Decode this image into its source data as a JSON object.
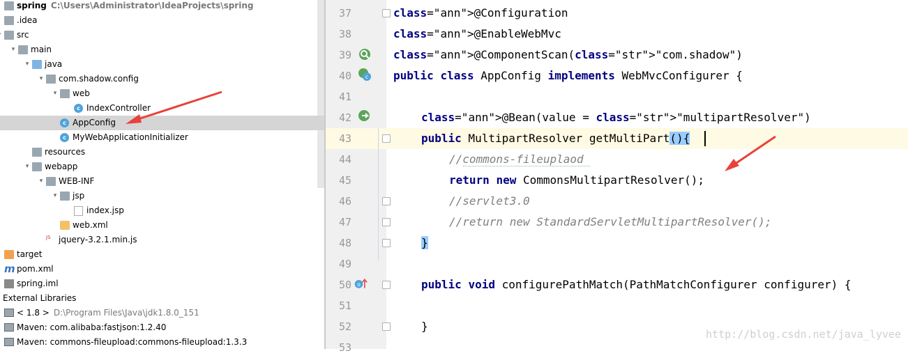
{
  "project": {
    "name": "spring",
    "path": "C:\\Users\\Administrator\\IdeaProjects\\spring"
  },
  "tree": [
    {
      "label": "spring",
      "depth": 0,
      "icon": "project-folder-icon",
      "bold": true
    },
    {
      "label": ".idea",
      "depth": 0,
      "icon": "folder-icon"
    },
    {
      "label": "src",
      "depth": 0,
      "icon": "folder-icon"
    },
    {
      "label": "main",
      "depth": 1,
      "icon": "folder-icon"
    },
    {
      "label": "java",
      "depth": 2,
      "icon": "source-folder-icon"
    },
    {
      "label": "com.shadow.config",
      "depth": 3,
      "icon": "package-icon"
    },
    {
      "label": "web",
      "depth": 4,
      "icon": "package-icon"
    },
    {
      "label": "IndexController",
      "depth": 5,
      "icon": "class-icon"
    },
    {
      "label": "AppConfig",
      "depth": 4,
      "icon": "class-icon"
    },
    {
      "label": "MyWebApplicationInitializer",
      "depth": 4,
      "icon": "class-icon"
    },
    {
      "label": "resources",
      "depth": 2,
      "icon": "resources-folder-icon"
    },
    {
      "label": "webapp",
      "depth": 2,
      "icon": "web-folder-icon"
    },
    {
      "label": "WEB-INF",
      "depth": 3,
      "icon": "folder-icon"
    },
    {
      "label": "jsp",
      "depth": 4,
      "icon": "folder-icon"
    },
    {
      "label": "index.jsp",
      "depth": 5,
      "icon": "jsp-icon"
    },
    {
      "label": "web.xml",
      "depth": 4,
      "icon": "xml-icon"
    },
    {
      "label": "jquery-3.2.1.min.js",
      "depth": 3,
      "icon": "js-icon"
    },
    {
      "label": "target",
      "depth": 0,
      "icon": "excluded-folder-icon"
    },
    {
      "label": "pom.xml",
      "depth": 0,
      "icon": "maven-icon"
    },
    {
      "label": "spring.iml",
      "depth": 0,
      "icon": "iml-icon"
    },
    {
      "label": "External Libraries",
      "depth": 0,
      "icon": "libraries-icon"
    },
    {
      "label": "< 1.8 >",
      "depth": 1,
      "icon": "jdk-icon",
      "path": "D:\\Program Files\\Java\\jdk1.8.0_151"
    },
    {
      "label": "Maven: com.alibaba:fastjson:1.2.40",
      "depth": 1,
      "icon": "library-icon"
    },
    {
      "label": "Maven: commons-fileupload:commons-fileupload:1.3.3",
      "depth": 1,
      "icon": "library-icon"
    }
  ],
  "editor": {
    "lines": [
      {
        "n": "37",
        "text": "@Configuration"
      },
      {
        "n": "38",
        "text": "@EnableWebMvc"
      },
      {
        "n": "39",
        "text": "@ComponentScan(\"com.shadow\")"
      },
      {
        "n": "40",
        "text": "public class AppConfig implements WebMvcConfigurer {"
      },
      {
        "n": "41",
        "text": ""
      },
      {
        "n": "42",
        "text": "@Bean(value = \"multipartResolver\")"
      },
      {
        "n": "43",
        "text": "public MultipartResolver getMultiPart(){"
      },
      {
        "n": "44",
        "text": "//commons-fileuplaod"
      },
      {
        "n": "45",
        "text": "return new CommonsMultipartResolver();"
      },
      {
        "n": "46",
        "text": "//servlet3.0"
      },
      {
        "n": "47",
        "text": "//return new StandardServletMultipartResolver();"
      },
      {
        "n": "48",
        "text": "}"
      },
      {
        "n": "49",
        "text": ""
      },
      {
        "n": "50",
        "text": "public void configurePathMatch(PathMatchConfigurer configurer) {"
      },
      {
        "n": "51",
        "text": ""
      },
      {
        "n": "52",
        "text": "}"
      },
      {
        "n": "53",
        "text": ""
      }
    ]
  },
  "watermark": "http://blog.csdn.net/java_lyvee",
  "colors": {
    "keyword": "#000080",
    "annotation": "#808000",
    "string": "#008000",
    "comment": "#808080",
    "selection": "#d5d5d5",
    "arrow": "#e8413b"
  }
}
